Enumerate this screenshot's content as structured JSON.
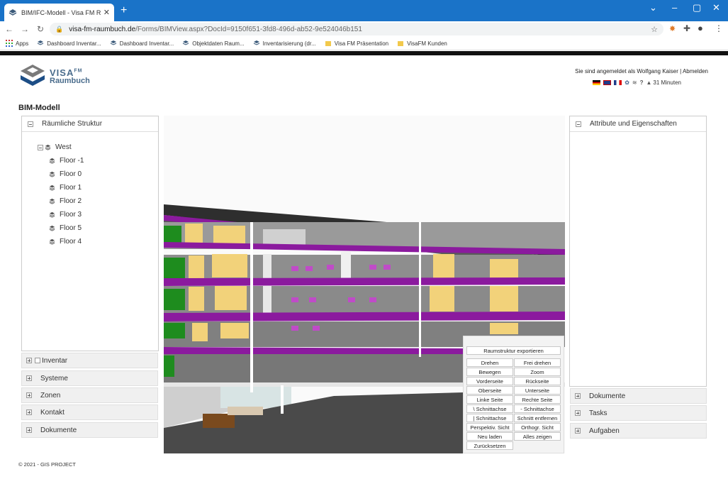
{
  "browser": {
    "tab_title": "BIM/IFC-Modell - Visa FM Raum",
    "new_tab": "+",
    "url_host": "visa-fm-raumbuch.de",
    "url_path": "/Forms/BIMView.aspx?DocId=9150f651-3fd8-496d-ab52-9e524046b151",
    "bookmarks": [
      {
        "label": "Apps",
        "icon": "apps-grid-icon"
      },
      {
        "label": "Dashboard Inventar...",
        "icon": "layers-icon"
      },
      {
        "label": "Dashboard Inventar...",
        "icon": "layers-icon"
      },
      {
        "label": "Objektdaten Raum...",
        "icon": "layers-icon"
      },
      {
        "label": "Inventarisierung (dr...",
        "icon": "layers-icon"
      },
      {
        "label": "Visa FM Präsentation",
        "icon": "folder-icon"
      },
      {
        "label": "VisaFM Kunden",
        "icon": "folder-icon"
      }
    ]
  },
  "app": {
    "logo_line1": "VISA",
    "logo_sup": "FM",
    "logo_line2": "Raumbuch",
    "login_text": "Sie sind angemeldet als Wolfgang Kaiser |",
    "logout": "Abmelden",
    "session_time": "31 Minuten",
    "page_title": "BIM-Modell",
    "footer": "© 2021 - GIS PROJECT"
  },
  "left": {
    "spatial_title": "Räumliche Struktur",
    "tree_root": "West",
    "floors": [
      "Floor -1",
      "Floor 0",
      "Floor 1",
      "Floor 2",
      "Floor 3",
      "Floor 5",
      "Floor 4"
    ],
    "accordions": [
      "Inventar",
      "Systeme",
      "Zonen",
      "Kontakt",
      "Dokumente"
    ]
  },
  "right": {
    "attr_title": "Attribute und Eigenschaften",
    "accordions": [
      "Dokumente",
      "Tasks",
      "Aufgaben"
    ]
  },
  "controls": {
    "export": "Raumstruktur exportieren",
    "buttons": [
      [
        "Drehen",
        "Frei drehen"
      ],
      [
        "Bewegen",
        "Zoom"
      ],
      [
        "Vorderseite",
        "Rückseite"
      ],
      [
        "Oberseite",
        "Unterseite"
      ],
      [
        "Linke Seite",
        "Rechte Seite"
      ],
      [
        "\\ Schnittachse",
        "- Schnittachse"
      ],
      [
        "| Schnittachse",
        "Schnitt entfernen"
      ],
      [
        "Perspektiv. Sicht",
        "Orthogr. Sicht"
      ],
      [
        "Neu laden",
        "Alles zeigen"
      ]
    ],
    "reset": "Zurücksetzen"
  },
  "colors": {
    "chrome_blue": "#1a73c8",
    "slab_purple": "#8b1a9e",
    "wall_yellow": "#f2d27a",
    "wall_green": "#1e8c1e",
    "floor_grey": "#5a5a5a"
  }
}
